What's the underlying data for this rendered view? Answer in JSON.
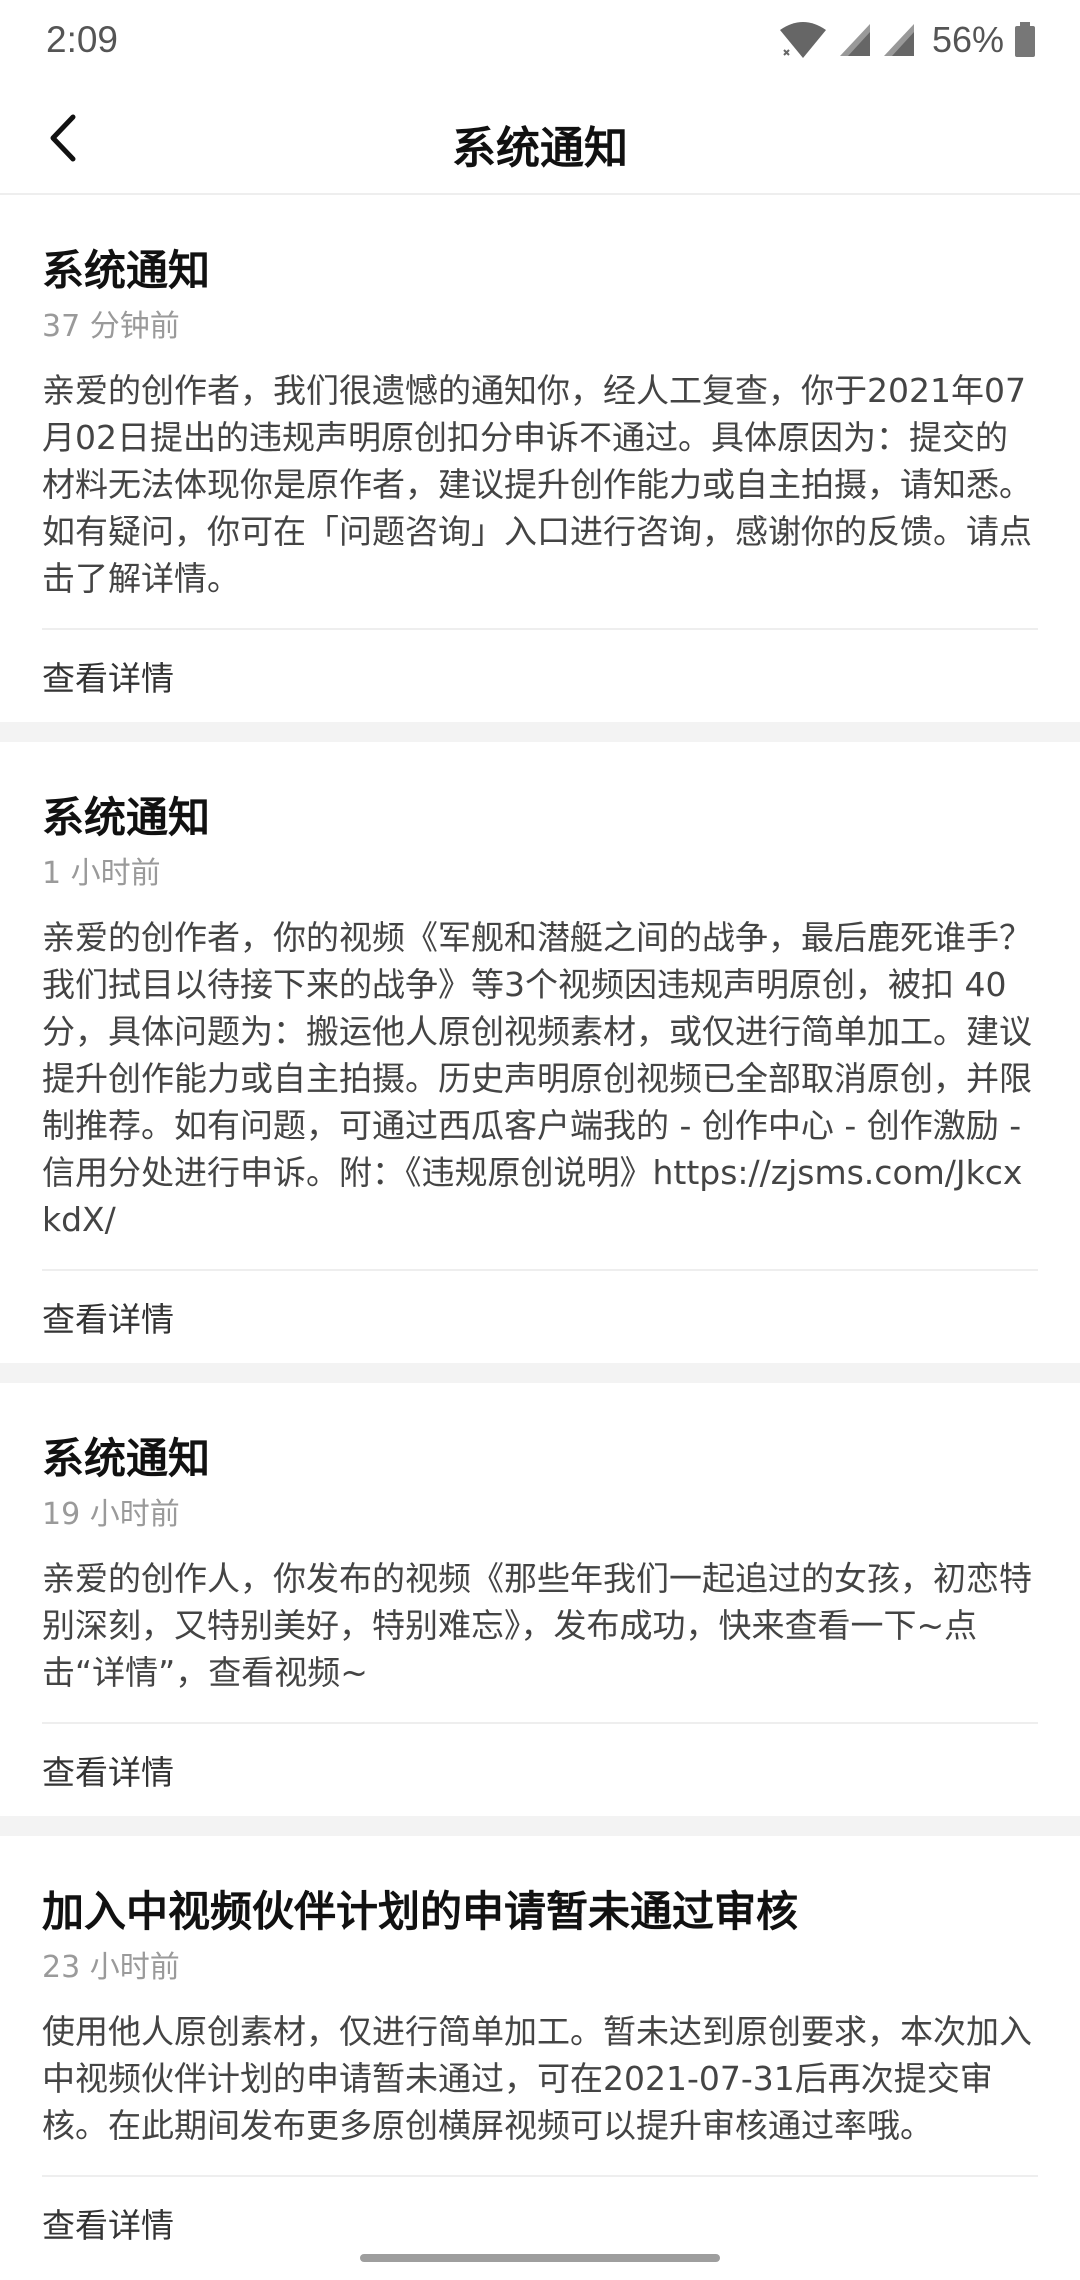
{
  "status": {
    "time": "2:09",
    "battery": "56%"
  },
  "nav": {
    "title": "系统通知"
  },
  "notifications": [
    {
      "title": "系统通知",
      "time": "37 分钟前",
      "body": "亲爱的创作者，我们很遗憾的通知你，经人工复查，你于2021年07月02日提出的违规声明原创扣分申诉不通过。具体原因为：提交的材料无法体现你是原作者，建议提升创作能力或自主拍摄，请知悉。如有疑问，你可在「问题咨询」入口进行咨询，感谢你的反馈。请点击了解详情。",
      "link": "查看详情"
    },
    {
      "title": "系统通知",
      "time": "1 小时前",
      "body": "亲爱的创作者，你的视频《军舰和潜艇之间的战争，最后鹿死谁手？我们拭目以待接下来的战争》等3个视频因违规声明原创，被扣 40 分，具体问题为：搬运他人原创视频素材，或仅进行简单加工。建议提升创作能力或自主拍摄。历史声明原创视频已全部取消原创，并限制推荐。如有问题，可通过西瓜客户端我的 - 创作中心 - 创作激励 - 信用分处进行申诉。附：《违规原创说明》https://zjsms.com/JkcxkdX/",
      "link": "查看详情"
    },
    {
      "title": "系统通知",
      "time": "19 小时前",
      "body": "亲爱的创作人，你发布的视频《那些年我们一起追过的女孩，初恋特别深刻，又特别美好，特别难忘》，发布成功，快来查看一下~点击“详情”，查看视频~",
      "link": "查看详情"
    },
    {
      "title": "加入中视频伙伴计划的申请暂未通过审核",
      "time": "23 小时前",
      "body": "使用他人原创素材，仅进行简单加工。暂未达到原创要求，本次加入中视频伙伴计划的申请暂未通过，可在2021-07-31后再次提交审核。在此期间发布更多原创横屏视频可以提升审核通过率哦。",
      "link": "查看详情"
    }
  ]
}
